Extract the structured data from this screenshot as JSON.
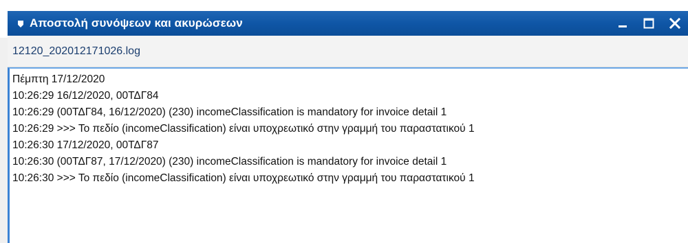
{
  "window": {
    "title": "Αποστολή συνόψεων και ακυρώσεων",
    "title_icon": "pin-icon",
    "controls": {
      "minimize_icon": "minimize-icon",
      "maximize_icon": "maximize-icon",
      "close_icon": "close-icon"
    }
  },
  "file": {
    "name": "12120_202012171026.log"
  },
  "log": {
    "lines": [
      "Πέμπτη 17/12/2020",
      "10:26:29 16/12/2020, 00ΤΔΓ84",
      "10:26:29 (00ΤΔΓ84, 16/12/2020) (230) incomeClassification is mandatory for invoice detail 1",
      "10:26:29 >>> Το πεδίο (incomeClassification) είναι υποχρεωτικό στην γραμμή του παραστατικού 1",
      "10:26:30 17/12/2020, 00ΤΔΓ87",
      "10:26:30 (00ΤΔΓ87, 17/12/2020) (230) incomeClassification is mandatory for invoice detail 1",
      "10:26:30 >>> Το πεδίο (incomeClassification) είναι υποχρεωτικό στην γραμμή του παραστατικού 1"
    ]
  },
  "colors": {
    "titlebar": "#0f56a6",
    "title_text": "#ffffff",
    "filename": "#1a3d6e",
    "pane_border": "#3b82d4"
  }
}
